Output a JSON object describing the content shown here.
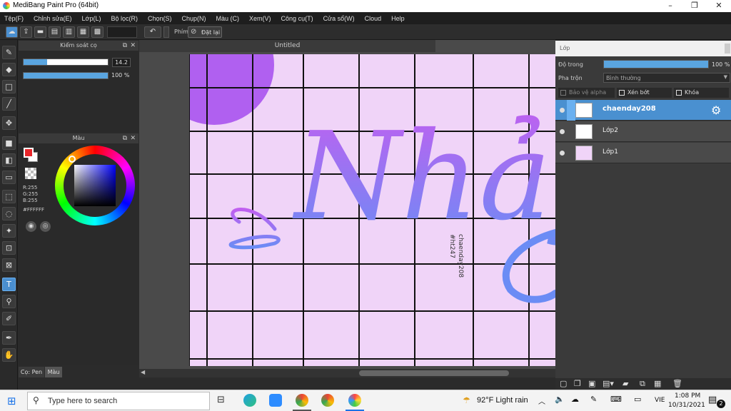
{
  "window": {
    "title": "MediBang Paint Pro (64bit)",
    "controls": [
      "–",
      "❐",
      "✕"
    ]
  },
  "menu": [
    "Tệp(F)",
    "Chỉnh sửa(E)",
    "Lớp(L)",
    "Bộ lọc(R)",
    "Chọn(S)",
    "Chụp(N)",
    "Màu (C)",
    "Xem(V)",
    "Công cụ(T)",
    "Cửa sổ(W)",
    "Cloud",
    "Help"
  ],
  "toolbar": {
    "shortcut_label": "Phím",
    "reset_label": "Đặt lại"
  },
  "brush_panel": {
    "title": "Kiểm soát cọ",
    "size_value": "14.2",
    "size_fraction": 0.28,
    "opacity_value": "100 %",
    "opacity_fraction": 1.0
  },
  "color_panel": {
    "title": "Màu",
    "r": "R:255",
    "g": "G:255",
    "b": "B:255",
    "hex": "#FFFFFF",
    "primary_color": "#e8262a",
    "secondary_color": "#ffffff"
  },
  "left_tabs": [
    "Cọ: Pen",
    "Màu"
  ],
  "canvas": {
    "tab_title": "Untitled",
    "lettering": "Nhảy",
    "side_text_1": "chaenday208",
    "side_text_2": "#ht247",
    "paper_color": "#f0d4f8",
    "grid_color": "#111111",
    "accent_purple": "#b060f0",
    "accent_blue": "#6b8cf5"
  },
  "layer_panel": {
    "title": "Lớp",
    "opacity_label": "Độ trong",
    "opacity_value": "100 %",
    "opacity_fraction": 1.0,
    "blend_label": "Pha trộn",
    "blend_value": "Bình thường",
    "protect_alpha": "Bảo vệ alpha",
    "clipping": "Xén bớt",
    "lock": "Khóa",
    "layers": [
      {
        "name": "chaenday208",
        "selected": true
      },
      {
        "name": "Lớp2",
        "selected": false
      },
      {
        "name": "Lớp1",
        "selected": false
      }
    ]
  },
  "taskbar": {
    "search_placeholder": "Type here to search",
    "weather": "92°F  Light rain",
    "language": "VIE",
    "time": "1:08 PM",
    "date": "10/31/2021",
    "notification_count": "2"
  }
}
